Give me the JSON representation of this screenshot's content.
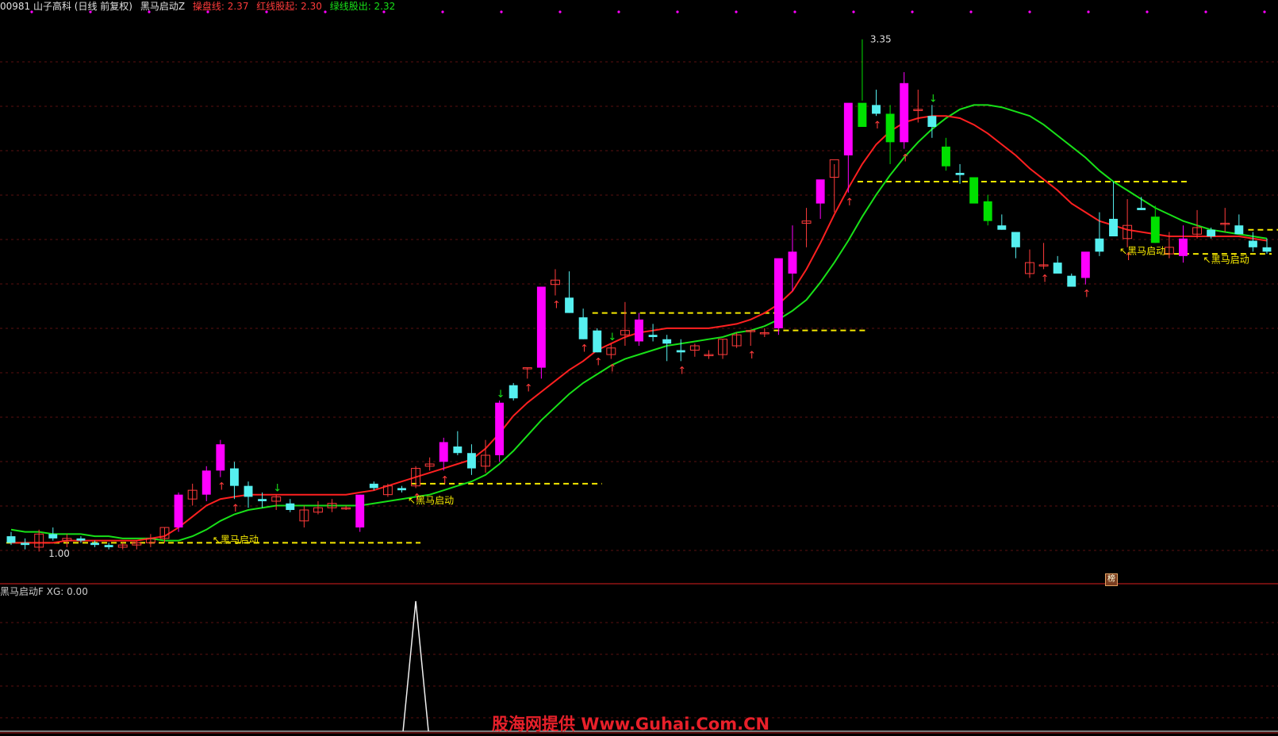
{
  "header": {
    "stock": "00981 山子高科 (日线 前复权)",
    "indicator_name": "黑马启动Z",
    "line1_label": "操盘线: 2.37",
    "line2_label": "红线股起: 2.30",
    "line3_label": "绿线股出: 2.32"
  },
  "sub_header": {
    "name": "黑马启动F",
    "value_label": "XG: 0.00"
  },
  "signal_label": "黑马启动",
  "watermark": "股海网提供 Www.Guhai.Com.CN",
  "icon_label": "榜",
  "colors": {
    "up": "#ff3b3b",
    "down": "#56f0f0",
    "strong_up": "#ff00ff",
    "strong_down": "#00e000",
    "red_line": "#ff2020",
    "green_line": "#18e018",
    "yellow": "#f5e800"
  },
  "chart_data": {
    "type": "candlestick",
    "price_range": [
      0.95,
      3.45
    ],
    "high_label": "3.35",
    "low_label": "1.00",
    "candles": [
      [
        1.08,
        1.1,
        1.04,
        1.05
      ],
      [
        1.05,
        1.07,
        1.02,
        1.04
      ],
      [
        1.03,
        1.11,
        1.01,
        1.09
      ],
      [
        1.09,
        1.12,
        1.06,
        1.07
      ],
      [
        1.06,
        1.09,
        1.03,
        1.07
      ],
      [
        1.07,
        1.08,
        1.05,
        1.06
      ],
      [
        1.05,
        1.06,
        1.03,
        1.04
      ],
      [
        1.04,
        1.05,
        1.02,
        1.03
      ],
      [
        1.03,
        1.05,
        1.02,
        1.04
      ],
      [
        1.04,
        1.06,
        1.02,
        1.05
      ],
      [
        1.05,
        1.09,
        1.03,
        1.07
      ],
      [
        1.07,
        1.12,
        1.05,
        1.12
      ],
      [
        1.12,
        1.28,
        1.1,
        1.27
      ],
      [
        1.25,
        1.32,
        1.22,
        1.29
      ],
      [
        1.27,
        1.4,
        1.24,
        1.38
      ],
      [
        1.38,
        1.52,
        1.35,
        1.5
      ],
      [
        1.39,
        1.42,
        1.25,
        1.31
      ],
      [
        1.31,
        1.33,
        1.21,
        1.26
      ],
      [
        1.25,
        1.28,
        1.21,
        1.24
      ],
      [
        1.24,
        1.27,
        1.2,
        1.26
      ],
      [
        1.23,
        1.25,
        1.19,
        1.2
      ],
      [
        1.15,
        1.22,
        1.12,
        1.2
      ],
      [
        1.19,
        1.24,
        1.18,
        1.21
      ],
      [
        1.21,
        1.25,
        1.19,
        1.23
      ],
      [
        1.21,
        1.22,
        1.2,
        1.21
      ],
      [
        1.12,
        1.27,
        1.1,
        1.27
      ],
      [
        1.32,
        1.33,
        1.29,
        1.3
      ],
      [
        1.27,
        1.32,
        1.26,
        1.31
      ],
      [
        1.3,
        1.31,
        1.28,
        1.29
      ],
      [
        1.31,
        1.4,
        1.3,
        1.39
      ],
      [
        1.4,
        1.44,
        1.38,
        1.41
      ],
      [
        1.42,
        1.53,
        1.38,
        1.51
      ],
      [
        1.49,
        1.56,
        1.45,
        1.46
      ],
      [
        1.46,
        1.5,
        1.36,
        1.39
      ],
      [
        1.4,
        1.52,
        1.37,
        1.45
      ],
      [
        1.45,
        1.7,
        1.42,
        1.69
      ],
      [
        1.77,
        1.78,
        1.7,
        1.71
      ],
      [
        1.85,
        1.85,
        1.8,
        1.85
      ],
      [
        1.85,
        2.2,
        1.8,
        2.22
      ],
      [
        2.23,
        2.3,
        2.18,
        2.25
      ],
      [
        2.17,
        2.29,
        2.1,
        2.1
      ],
      [
        2.08,
        2.12,
        1.98,
        1.98
      ],
      [
        2.02,
        2.03,
        1.92,
        1.92
      ],
      [
        1.91,
        1.96,
        1.89,
        1.94
      ],
      [
        2.0,
        2.15,
        1.95,
        2.02
      ],
      [
        1.97,
        2.1,
        1.95,
        2.07
      ],
      [
        2.0,
        2.05,
        1.97,
        1.99
      ],
      [
        1.98,
        2.0,
        1.88,
        1.96
      ],
      [
        1.93,
        1.98,
        1.88,
        1.92
      ],
      [
        1.93,
        1.96,
        1.9,
        1.95
      ],
      [
        1.91,
        1.93,
        1.89,
        1.91
      ],
      [
        1.91,
        1.98,
        1.89,
        1.98
      ],
      [
        1.95,
        2.01,
        1.94,
        2.0
      ],
      [
        2.02,
        2.02,
        1.95,
        2.02
      ],
      [
        2.01,
        2.03,
        1.99,
        2.01
      ],
      [
        2.03,
        2.32,
        2.0,
        2.35
      ],
      [
        2.28,
        2.5,
        2.2,
        2.38
      ],
      [
        2.51,
        2.58,
        2.4,
        2.52
      ],
      [
        2.6,
        2.7,
        2.53,
        2.71
      ],
      [
        2.72,
        2.78,
        2.56,
        2.8
      ],
      [
        2.82,
        2.92,
        2.65,
        3.06
      ],
      [
        3.06,
        3.35,
        3.07,
        2.95
      ],
      [
        3.05,
        3.12,
        3.0,
        3.01
      ],
      [
        3.01,
        3.05,
        2.78,
        2.88
      ],
      [
        2.88,
        3.2,
        2.85,
        3.15
      ],
      [
        3.03,
        3.12,
        2.97,
        3.03
      ],
      [
        3.0,
        3.05,
        2.9,
        2.95
      ],
      [
        2.86,
        2.9,
        2.75,
        2.77
      ],
      [
        2.74,
        2.78,
        2.69,
        2.73
      ],
      [
        2.72,
        2.7,
        2.62,
        2.6
      ],
      [
        2.61,
        2.64,
        2.5,
        2.52
      ],
      [
        2.5,
        2.55,
        2.48,
        2.48
      ],
      [
        2.47,
        2.47,
        2.35,
        2.4
      ],
      [
        2.28,
        2.39,
        2.26,
        2.33
      ],
      [
        2.32,
        2.42,
        2.3,
        2.32
      ],
      [
        2.33,
        2.36,
        2.3,
        2.28
      ],
      [
        2.27,
        2.28,
        2.23,
        2.22
      ],
      [
        2.26,
        2.35,
        2.23,
        2.38
      ],
      [
        2.44,
        2.56,
        2.36,
        2.38
      ],
      [
        2.53,
        2.7,
        2.5,
        2.45
      ],
      [
        2.44,
        2.62,
        2.4,
        2.5
      ],
      [
        2.58,
        2.63,
        2.57,
        2.57
      ],
      [
        2.54,
        2.59,
        2.42,
        2.42
      ],
      [
        2.37,
        2.47,
        2.35,
        2.4
      ],
      [
        2.36,
        2.5,
        2.33,
        2.44
      ],
      [
        2.46,
        2.57,
        2.44,
        2.49
      ],
      [
        2.48,
        2.49,
        2.44,
        2.45
      ],
      [
        2.51,
        2.58,
        2.47,
        2.51
      ],
      [
        2.5,
        2.55,
        2.47,
        2.46
      ],
      [
        2.43,
        2.47,
        2.38,
        2.4
      ],
      [
        2.4,
        2.44,
        2.37,
        2.38
      ]
    ],
    "red_line": [
      1.05,
      1.05,
      1.05,
      1.05,
      1.06,
      1.06,
      1.06,
      1.06,
      1.06,
      1.06,
      1.07,
      1.08,
      1.12,
      1.17,
      1.22,
      1.25,
      1.26,
      1.27,
      1.27,
      1.27,
      1.27,
      1.27,
      1.27,
      1.27,
      1.27,
      1.28,
      1.29,
      1.31,
      1.33,
      1.35,
      1.37,
      1.39,
      1.41,
      1.43,
      1.48,
      1.55,
      1.63,
      1.69,
      1.74,
      1.79,
      1.84,
      1.88,
      1.93,
      1.96,
      1.99,
      2.01,
      2.02,
      2.03,
      2.03,
      2.03,
      2.03,
      2.04,
      2.05,
      2.07,
      2.1,
      2.14,
      2.2,
      2.3,
      2.42,
      2.55,
      2.67,
      2.78,
      2.87,
      2.93,
      2.97,
      2.99,
      3.0,
      3.0,
      2.99,
      2.96,
      2.92,
      2.87,
      2.82,
      2.76,
      2.71,
      2.66,
      2.6,
      2.56,
      2.52,
      2.5,
      2.48,
      2.47,
      2.46,
      2.45,
      2.45,
      2.45,
      2.45,
      2.45,
      2.45,
      2.44,
      2.43
    ],
    "green_line": [
      1.11,
      1.1,
      1.1,
      1.09,
      1.09,
      1.09,
      1.08,
      1.08,
      1.07,
      1.07,
      1.07,
      1.06,
      1.06,
      1.08,
      1.11,
      1.15,
      1.18,
      1.2,
      1.21,
      1.22,
      1.22,
      1.22,
      1.22,
      1.22,
      1.22,
      1.22,
      1.23,
      1.24,
      1.25,
      1.26,
      1.27,
      1.29,
      1.31,
      1.33,
      1.36,
      1.41,
      1.47,
      1.54,
      1.61,
      1.67,
      1.73,
      1.78,
      1.82,
      1.86,
      1.89,
      1.91,
      1.93,
      1.95,
      1.96,
      1.97,
      1.98,
      1.99,
      2.01,
      2.02,
      2.04,
      2.07,
      2.11,
      2.16,
      2.24,
      2.33,
      2.43,
      2.54,
      2.64,
      2.73,
      2.81,
      2.88,
      2.94,
      2.99,
      3.03,
      3.05,
      3.05,
      3.04,
      3.02,
      3.0,
      2.96,
      2.91,
      2.86,
      2.81,
      2.75,
      2.7,
      2.66,
      2.62,
      2.58,
      2.55,
      2.52,
      2.5,
      2.48,
      2.47,
      2.46,
      2.45,
      2.44
    ],
    "xg_spike_index": 29
  }
}
